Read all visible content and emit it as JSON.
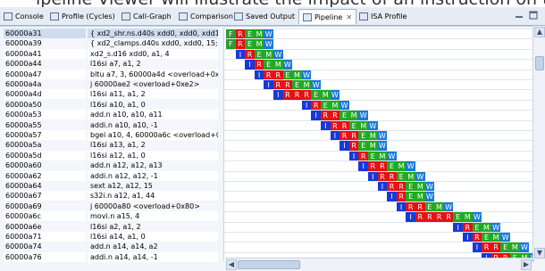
{
  "caption_fragment": "ipeline Viewer will illustrate the impact of an instruction on the",
  "tabs": [
    {
      "label": "Console",
      "icon": "console-icon"
    },
    {
      "label": "Profile (Cycles)",
      "icon": "profile-icon"
    },
    {
      "label": "Call-Graph",
      "icon": "call-graph-icon"
    },
    {
      "label": "Comparison",
      "icon": "comparison-icon"
    },
    {
      "label": "Saved Output",
      "icon": "saved-output-icon"
    },
    {
      "label": "Pipeline",
      "icon": "pipeline-icon",
      "active": true
    },
    {
      "label": "ISA Profile",
      "icon": "isa-profile-icon"
    }
  ],
  "rows": [
    {
      "addr": "60000a31",
      "instr": "{ xd2_shr.ns.d40s xdd0, xdd0, xdd1",
      "stages": "FREMW",
      "start": 0
    },
    {
      "addr": "60000a39",
      "instr": "{ xd2_clamps.d40s xdd0, xdd0, 15; ",
      "stages": "FREMW",
      "start": 0
    },
    {
      "addr": "60000a41",
      "instr": "xd2_s.d16 xdd0, a1, 4",
      "stages": "IREMW",
      "start": 1
    },
    {
      "addr": "60000a44",
      "instr": "l16si a7, a1, 2",
      "stages": "IREMW",
      "start": 2
    },
    {
      "addr": "60000a47",
      "instr": "bltu a7, 3, 60000a4d <overload+0x4d>",
      "stages": "IRREMW",
      "start": 3
    },
    {
      "addr": "60000a4a",
      "instr": "j 60000ae2 <overload+0xe2>",
      "stages": "IRREMW",
      "start": 4
    },
    {
      "addr": "60000a4d",
      "instr": "l16si a11, a1, 2",
      "stages": "IRRREMW",
      "start": 5
    },
    {
      "addr": "60000a50",
      "instr": "l16si a10, a1, 0",
      "stages": "IREMW",
      "start": 8
    },
    {
      "addr": "60000a53",
      "instr": "add.n a10, a10, a11",
      "stages": "IRREMW",
      "start": 9
    },
    {
      "addr": "60000a55",
      "instr": "addi.n a10, a10, -1",
      "stages": "IRREMW",
      "start": 10
    },
    {
      "addr": "60000a57",
      "instr": "bgei a10, 4, 60000a6c <overload+0x6c>",
      "stages": "IRREMW",
      "start": 11
    },
    {
      "addr": "60000a5a",
      "instr": "l16si a13, a1, 2",
      "stages": "IREMW",
      "start": 12
    },
    {
      "addr": "60000a5d",
      "instr": "l16si a12, a1, 0",
      "stages": "IREMW",
      "start": 13
    },
    {
      "addr": "60000a60",
      "instr": "add.n a12, a12, a13",
      "stages": "IRREMW",
      "start": 14
    },
    {
      "addr": "60000a62",
      "instr": "addi.n a12, a12, -1",
      "stages": "IRREMW",
      "start": 15
    },
    {
      "addr": "60000a64",
      "instr": "sext a12, a12, 15",
      "stages": "IRREMW",
      "start": 16
    },
    {
      "addr": "60000a67",
      "instr": "s32i.n a12, a1, 44",
      "stages": "IREMW",
      "start": 17
    },
    {
      "addr": "60000a69",
      "instr": "j 60000a80 <overload+0x80>",
      "stages": "IRREMW",
      "start": 18
    },
    {
      "addr": "60000a6c",
      "instr": "movi.n a15, 4",
      "stages": "IRRRREMW",
      "start": 19
    },
    {
      "addr": "60000a6e",
      "instr": "l16si a2, a1, 2",
      "stages": "IREMW",
      "start": 24
    },
    {
      "addr": "60000a71",
      "instr": "l16si a14, a1, 0",
      "stages": "IREMW",
      "start": 25
    },
    {
      "addr": "60000a74",
      "instr": "add.n a14, a14, a2",
      "stages": "IRREMW",
      "start": 26
    },
    {
      "addr": "60000a76",
      "instr": "addi.n a14, a14, -1",
      "stages": "IRREMW",
      "start": 27
    }
  ],
  "colors": {
    "F": "#2e9a2e",
    "I": "#1838d8",
    "R": "#e81010",
    "E": "#22aa22",
    "M": "#22aa22",
    "W": "#1a7ad8"
  }
}
